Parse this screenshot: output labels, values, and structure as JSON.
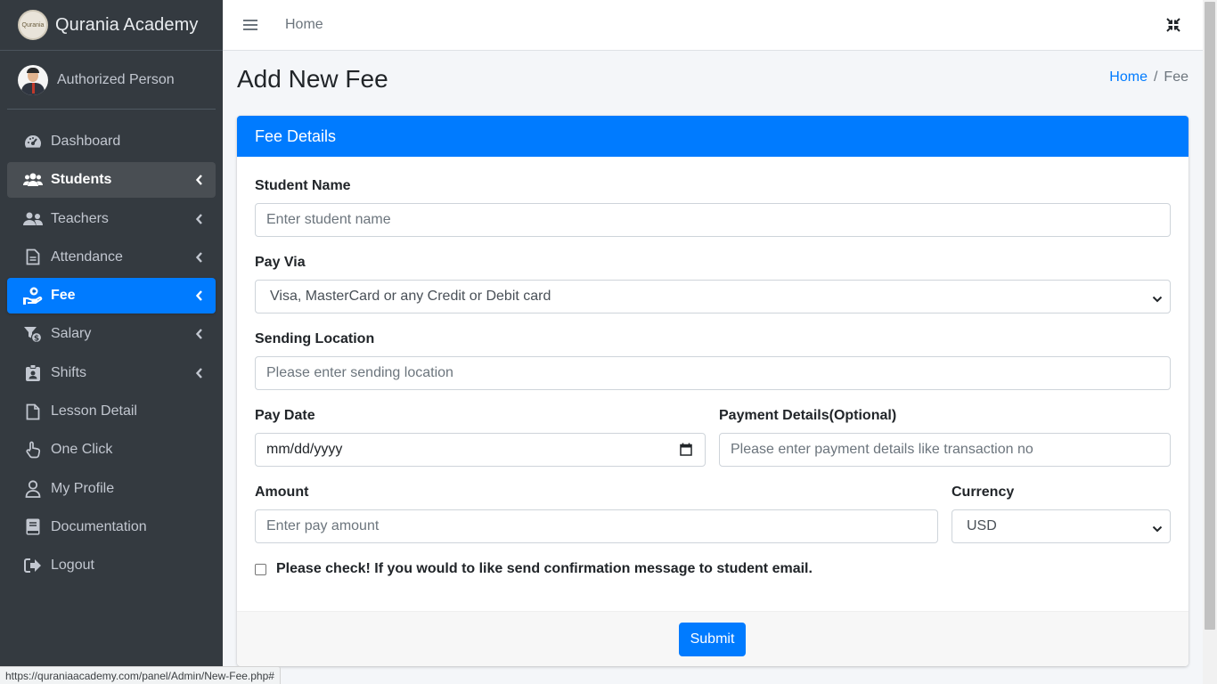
{
  "brand": {
    "name": "Qurania Academy",
    "logo_text": "Qurania"
  },
  "user": {
    "name": "Authorized Person"
  },
  "sidebar": {
    "items": [
      {
        "label": "Dashboard",
        "icon": "tachometer-icon"
      },
      {
        "label": "Students",
        "icon": "users-icon"
      },
      {
        "label": "Teachers",
        "icon": "user-friends-icon"
      },
      {
        "label": "Attendance",
        "icon": "file-alt-icon"
      },
      {
        "label": "Fee",
        "icon": "hand-holding-dollar-icon"
      },
      {
        "label": "Salary",
        "icon": "coins-icon"
      },
      {
        "label": "Shifts",
        "icon": "id-badge-icon"
      },
      {
        "label": "Lesson Detail",
        "icon": "file-icon"
      },
      {
        "label": "One Click",
        "icon": "hand-pointer-icon"
      },
      {
        "label": "My Profile",
        "icon": "user-icon"
      },
      {
        "label": "Documentation",
        "icon": "book-icon"
      },
      {
        "label": "Logout",
        "icon": "sign-out-icon"
      }
    ]
  },
  "topbar": {
    "home": "Home"
  },
  "page": {
    "title": "Add New Fee"
  },
  "breadcrumb": {
    "home": "Home",
    "separator": "/",
    "current": "Fee"
  },
  "card": {
    "header": "Fee Details",
    "student_name": {
      "label": "Student Name",
      "placeholder": "Enter student name"
    },
    "pay_via": {
      "label": "Pay Via",
      "value": "Visa, MasterCard or any Credit or Debit card"
    },
    "sending_location": {
      "label": "Sending Location",
      "placeholder": "Please enter sending location"
    },
    "pay_date": {
      "label": "Pay Date",
      "placeholder": "mm/dd/yyyy"
    },
    "payment_details": {
      "label": "Payment Details(Optional)",
      "placeholder": "Please enter payment details like transaction no"
    },
    "amount": {
      "label": "Amount",
      "placeholder": "Enter pay amount"
    },
    "currency": {
      "label": "Currency",
      "value": "USD"
    },
    "confirm_checkbox": {
      "label": "Please check! If you would to like send confirmation message to student email."
    },
    "submit": "Submit"
  },
  "statusbar": {
    "url": "https://quraniaacademy.com/panel/Admin/New-Fee.php#"
  },
  "colors": {
    "primary": "#007bff",
    "sidebar_bg": "#343a40",
    "sidebar_text": "#c2c7d0"
  }
}
